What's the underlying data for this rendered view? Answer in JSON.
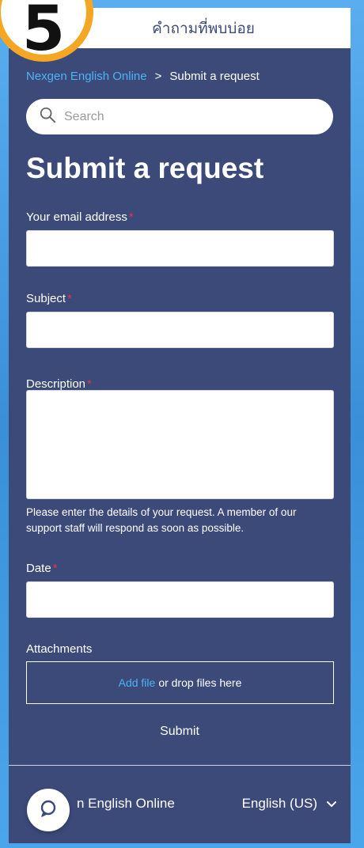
{
  "step_badge": "5",
  "header": {
    "title": "คำถามที่พบบ่อย"
  },
  "breadcrumb": {
    "home": "Nexgen English Online",
    "separator": ">",
    "current": "Submit a request"
  },
  "search": {
    "placeholder": "Search"
  },
  "page_title": "Submit a request",
  "form": {
    "required_mark": "*",
    "email": {
      "label": "Your email address",
      "value": ""
    },
    "subject": {
      "label": "Subject",
      "value": ""
    },
    "description": {
      "label": "Description",
      "value": "",
      "help": "Please enter the details of your request. A member of our support staff will respond as soon as possible."
    },
    "date": {
      "label": "Date",
      "value": ""
    },
    "attachments": {
      "label": "Attachments",
      "add_file": "Add file",
      "drop_text": "or drop files here"
    },
    "submit_label": "Submit"
  },
  "footer": {
    "brand": "n English Online",
    "language": "English (US)"
  },
  "colors": {
    "background": "#3c4a7a",
    "link": "#4db3f5",
    "required": "#e0364a",
    "badge_ring": "#f5a623"
  }
}
